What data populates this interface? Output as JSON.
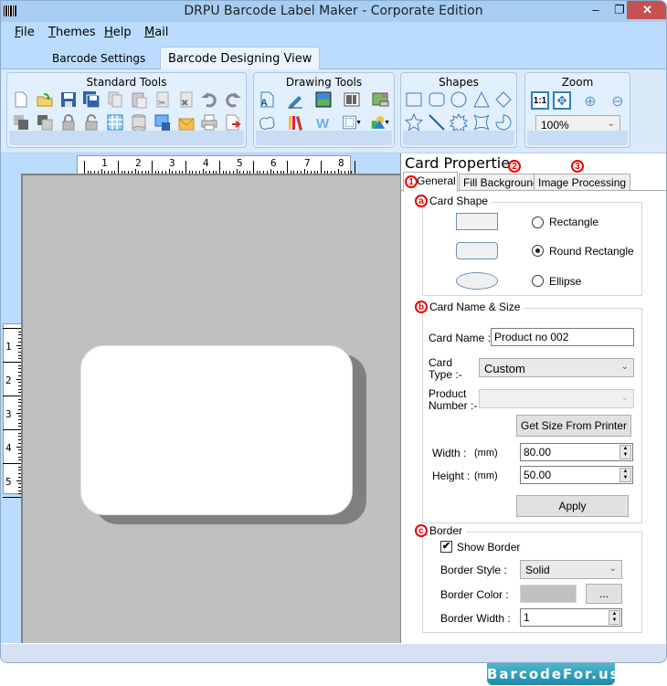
{
  "window": {
    "title": "DRPU Barcode Label Maker - Corporate Edition",
    "minimize": "–",
    "maximize": "❐",
    "close": "✕"
  },
  "menu": [
    {
      "first": "F",
      "rest": "ile"
    },
    {
      "first": "T",
      "rest": "hemes"
    },
    {
      "first": "H",
      "rest": "elp"
    },
    {
      "first": "M",
      "rest": "ail"
    }
  ],
  "main_tabs": [
    "Barcode Settings",
    "Barcode Designing View"
  ],
  "ribbon": {
    "standard_tools": "Standard Tools",
    "drawing_tools": "Drawing Tools",
    "shapes": "Shapes",
    "zoom": "Zoom",
    "zoom_value": "100%",
    "zoom_arrow": "⌵",
    "standard_icons": [
      "new-icon",
      "open-icon",
      "save-icon",
      "save-as-icon",
      "copy-icon",
      "paste-icon",
      "cut-icon",
      "delete-icon",
      "undo-icon",
      "redo-icon",
      "send-back-icon",
      "bring-front-icon",
      "lock-icon",
      "unlock-icon",
      "grid-icon",
      "database-icon",
      "export-image-icon",
      "email-icon",
      "print-icon",
      "export-pdf-icon"
    ],
    "drawing_icons": [
      "text-icon",
      "pen-icon",
      "picture-icon",
      "barcode-icon",
      "image-icon",
      "blob-shape-icon",
      "library-icon",
      "watermark-icon",
      "border-icon",
      "signature-shape-icon"
    ],
    "shape_icons": [
      "rectangle-icon",
      "rounded-rectangle-icon",
      "ellipse-icon",
      "triangle-icon",
      "diamond-icon",
      "star-icon",
      "line-icon",
      "burst-icon",
      "four-point-star-icon",
      "pie-icon"
    ]
  },
  "rulers": {
    "horizontal": [
      "1",
      "2",
      "3",
      "4",
      "5",
      "6",
      "7",
      "8"
    ],
    "vertical": [
      "1",
      "2",
      "3",
      "4",
      "5"
    ]
  },
  "panel": {
    "title": "Card Properties",
    "tabs": [
      "General",
      "Fill Background",
      "Image Processing"
    ],
    "tab_markers": [
      "1",
      "2",
      "3"
    ],
    "card_shape": {
      "legend": "Card Shape",
      "marker": "a",
      "options": [
        {
          "label": "Rectangle",
          "checked": false
        },
        {
          "label": "Round Rectangle",
          "checked": true
        },
        {
          "label": "Ellipse",
          "checked": false
        }
      ]
    },
    "card_name_size": {
      "legend": "Card  Name & Size",
      "marker": "b",
      "card_name_label": "Card Name :",
      "card_name_value": "Product no 002",
      "card_type_label_1": "Card",
      "card_type_label_2": "Type :-",
      "card_type_value": "Custom",
      "product_number_label_1": "Product",
      "product_number_label_2": "Number :-",
      "product_number_value": "",
      "get_size_button": "Get Size From Printer",
      "width_label": "Width :",
      "width_unit": "(mm)",
      "width_value": "80.00",
      "height_label": "Height :",
      "height_unit": "(mm)",
      "height_value": "50.00",
      "apply_button": "Apply"
    },
    "border": {
      "legend": "Border",
      "marker": "c",
      "show_border_label": "Show Border",
      "show_border_checked": true,
      "check_mark": "✔",
      "style_label": "Border Style :",
      "style_value": "Solid",
      "color_label": "Border Color :",
      "color_value": "#c0c0c0",
      "color_button": "...",
      "width_label": "Border Width :",
      "width_value": "1"
    }
  },
  "spin_up": "▲",
  "spin_down": "▼",
  "watermark": "BarcodeFor.us"
}
